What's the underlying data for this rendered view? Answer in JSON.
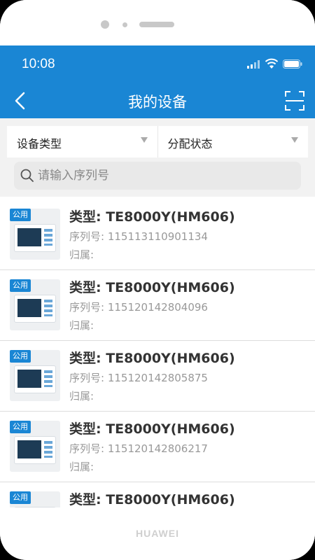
{
  "status": {
    "time": "10:08"
  },
  "nav": {
    "title": "我的设备"
  },
  "filters": [
    {
      "label": "设备类型"
    },
    {
      "label": "分配状态"
    }
  ],
  "search": {
    "placeholder": "请输入序列号",
    "value": ""
  },
  "devices": [
    {
      "tag": "公用",
      "title": "类型: TE8000Y(HM606)",
      "serial": "序列号: 115113110901134",
      "owner": "归属:"
    },
    {
      "tag": "公用",
      "title": "类型: TE8000Y(HM606)",
      "serial": "序列号: 115120142804096",
      "owner": "归属:"
    },
    {
      "tag": "公用",
      "title": "类型: TE8000Y(HM606)",
      "serial": "序列号: 115120142805875",
      "owner": "归属:"
    },
    {
      "tag": "公用",
      "title": "类型: TE8000Y(HM606)",
      "serial": "序列号: 115120142806217",
      "owner": "归属:"
    },
    {
      "tag": "公用",
      "title": "类型: TE8000Y(HM606)",
      "serial": "",
      "owner": ""
    }
  ],
  "device_brand": "HUAWEI",
  "colors": {
    "primary": "#1a86d4",
    "tag": "#1a86d4"
  },
  "icons": [
    "back-arrow-icon",
    "scan-icon",
    "search-icon",
    "signal-icon",
    "wifi-icon",
    "battery-icon",
    "dropdown-caret-icon"
  ]
}
